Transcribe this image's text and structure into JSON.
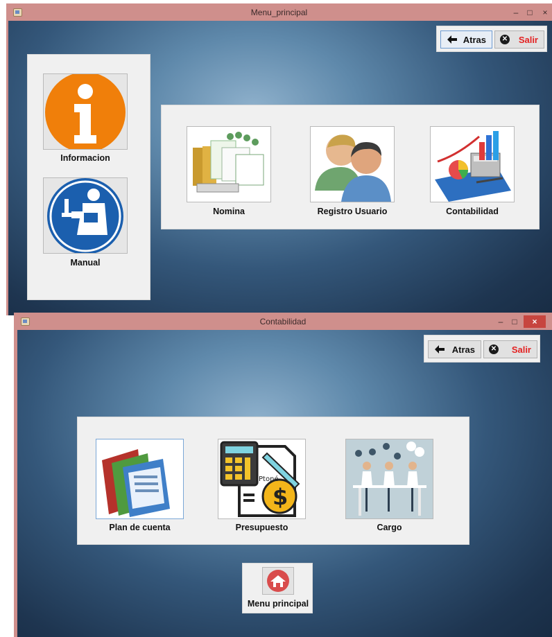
{
  "window1": {
    "title": "Menu_principal",
    "controls": {
      "minimize": "–",
      "maximize": "□",
      "close": "×"
    },
    "nav": {
      "back_label": "Atras",
      "exit_label": "Salir"
    },
    "side_tiles": [
      {
        "label": "Informacion",
        "icon": "info-icon"
      },
      {
        "label": "Manual",
        "icon": "manual-reader-icon"
      }
    ],
    "main_tiles": [
      {
        "label": "Nomina",
        "icon": "payroll-documents-icon"
      },
      {
        "label": "Registro Usuario",
        "icon": "users-icon"
      },
      {
        "label": "Contabilidad",
        "icon": "accounting-chart-icon"
      }
    ]
  },
  "window2": {
    "title": "Contabilidad",
    "controls": {
      "minimize": "–",
      "maximize": "□",
      "close": "×"
    },
    "nav": {
      "back_label": "Atras",
      "exit_label": "Salir"
    },
    "tiles": [
      {
        "label": "Plan de cuenta",
        "icon": "account-folders-icon"
      },
      {
        "label": "Presupuesto",
        "icon": "budget-calculator-icon",
        "image_text": "Ptoné"
      },
      {
        "label": "Cargo",
        "icon": "positions-team-icon"
      }
    ],
    "home": {
      "label": "Menu principal",
      "icon": "home-icon"
    }
  },
  "colors": {
    "titlebar": "#cf8f8c",
    "close_red": "#c7453f",
    "exit_text": "#e32222",
    "panel": "#f0f0f0"
  }
}
